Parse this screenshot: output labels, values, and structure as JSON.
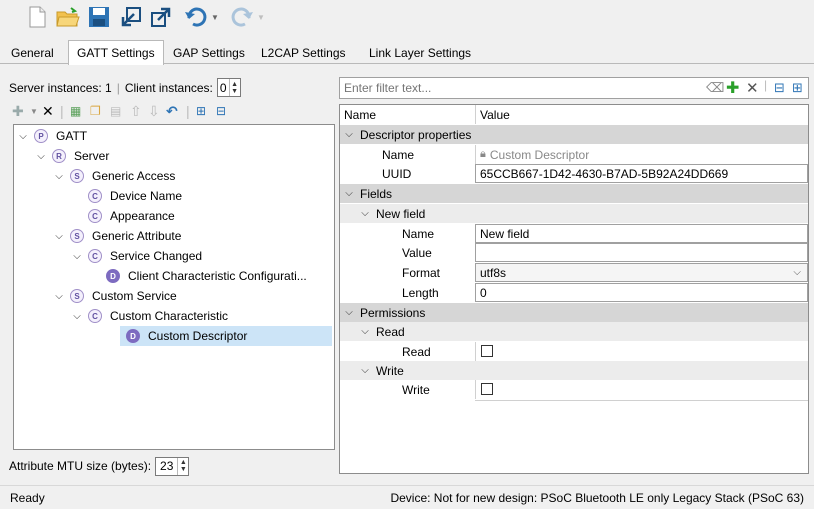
{
  "toolbar": {
    "buttons": [
      "new-file-icon",
      "open-folder-icon",
      "save-icon",
      "import-icon",
      "export-icon",
      "undo-icon",
      "redo-icon"
    ]
  },
  "tabs": [
    "General",
    "GATT Settings",
    "GAP Settings",
    "L2CAP Settings",
    "Link Layer Settings"
  ],
  "left": {
    "server_instances_label": "Server instances: 1",
    "client_instances_label": "Client instances:",
    "client_instances_value": "0",
    "mtu_label": "Attribute MTU size (bytes):",
    "mtu_value": "23"
  },
  "tree": [
    {
      "badge": "P",
      "label": "GATT"
    },
    {
      "badge": "R",
      "label": "Server"
    },
    {
      "badge": "S",
      "label": "Generic Access"
    },
    {
      "badge": "C",
      "label": "Device Name"
    },
    {
      "badge": "C",
      "label": "Appearance"
    },
    {
      "badge": "S",
      "label": "Generic Attribute"
    },
    {
      "badge": "C",
      "label": "Service Changed"
    },
    {
      "badge": "D",
      "label": "Client Characteristic Configurati..."
    },
    {
      "badge": "S",
      "label": "Custom Service"
    },
    {
      "badge": "C",
      "label": "Custom Characteristic"
    },
    {
      "badge": "D",
      "label": "Custom Descriptor"
    }
  ],
  "filter": {
    "placeholder": "Enter filter text..."
  },
  "grid": {
    "col_name": "Name",
    "col_value": "Value",
    "descriptor_properties": "Descriptor properties",
    "name_label": "Name",
    "name_value": "Custom Descriptor",
    "uuid_label": "UUID",
    "uuid_value": "65CCB667-1D42-4630-B7AD-5B92A24DD669",
    "fields": "Fields",
    "new_field": "New field",
    "field_name_label": "Name",
    "field_name_value": "New field",
    "field_value_label": "Value",
    "field_value_value": "",
    "format_label": "Format",
    "format_value": "utf8s",
    "length_label": "Length",
    "length_value": "0",
    "permissions": "Permissions",
    "read": "Read",
    "read_label": "Read",
    "write": "Write",
    "write_label": "Write"
  },
  "status": {
    "left": "Ready",
    "right": "Device: Not for new design: PSoC Bluetooth LE only Legacy Stack (PSoC 63)"
  },
  "colors": {
    "accent": "#2e74b5",
    "selection": "#cce4f7",
    "green": "#2aa02a"
  }
}
